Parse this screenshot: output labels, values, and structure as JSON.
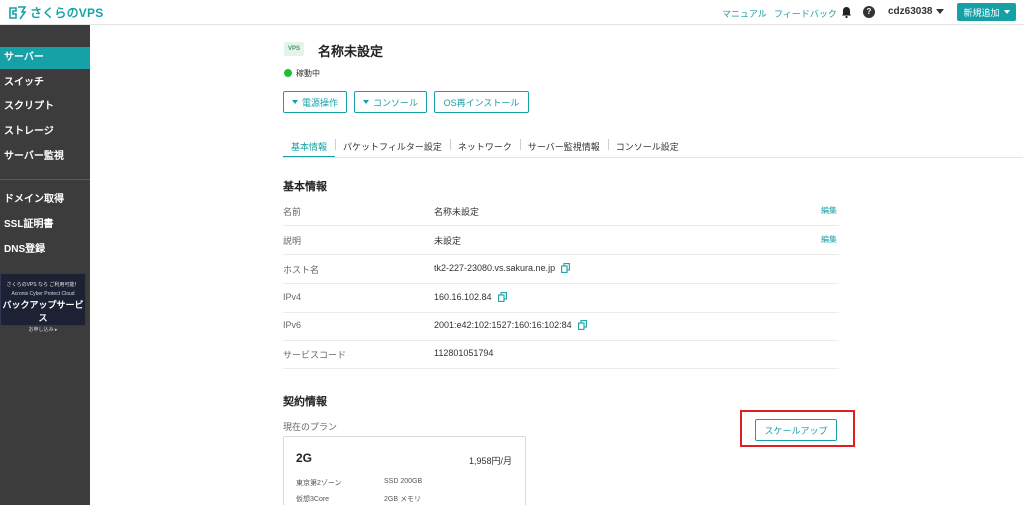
{
  "brand": {
    "name": "さくらのVPS"
  },
  "header": {
    "manual_link": "マニュアル",
    "feedback_link": "フィードバック",
    "help_glyph": "?",
    "username": "cdz63038",
    "new_button": "新規追加"
  },
  "sidebar": {
    "items": [
      {
        "label": "サーバー",
        "active": true
      },
      {
        "label": "スイッチ"
      },
      {
        "label": "スクリプト"
      },
      {
        "label": "ストレージ"
      },
      {
        "label": "サーバー監視"
      }
    ],
    "items2": [
      {
        "label": "ドメイン取得"
      },
      {
        "label": "SSL証明書"
      },
      {
        "label": "DNS登録"
      }
    ],
    "banner": {
      "line1": "さくらのVPS なら ご利用可能！",
      "line2": "Acronis Cyber Protect Cloud",
      "line3": "バックアップサービス",
      "line4": "お申し込み ▸"
    }
  },
  "server": {
    "badge": "VPS",
    "name": "名称未設定",
    "status": "稼動中",
    "status_color": "#1fbf35"
  },
  "actions": {
    "power": "電源操作",
    "console": "コンソール",
    "reinstall": "OS再インストール"
  },
  "tabs": [
    {
      "label": "基本情報",
      "active": true
    },
    {
      "label": "パケットフィルター設定"
    },
    {
      "label": "ネットワーク"
    },
    {
      "label": "サーバー監視情報"
    },
    {
      "label": "コンソール設定"
    }
  ],
  "basic": {
    "title": "基本情報",
    "edit_label": "編集",
    "rows": [
      {
        "label": "名前",
        "value": "名称未設定"
      },
      {
        "label": "説明",
        "value": "未設定"
      },
      {
        "label": "ホスト名",
        "value": "tk2-227-23080.vs.sakura.ne.jp"
      },
      {
        "label": "IPv4",
        "value": "160.16.102.84"
      },
      {
        "label": "IPv6",
        "value": "2001:e42:102:1527:160:16:102:84"
      },
      {
        "label": "サービスコード",
        "value": "112801051794"
      }
    ]
  },
  "contract": {
    "title": "契約情報",
    "current_plan_label": "現在のプラン",
    "plan_name": "2G",
    "price": "1,958円/月",
    "zone": "東京第2ゾーン",
    "storage": "SSD 200GB",
    "cpu": "仮想3Core",
    "memory": "2GB メモリ",
    "scale_up": "スケールアップ"
  },
  "colors": {
    "accent": "#16a1a7",
    "sidebar": "#3c3c3c",
    "highlight": "#e02020"
  }
}
